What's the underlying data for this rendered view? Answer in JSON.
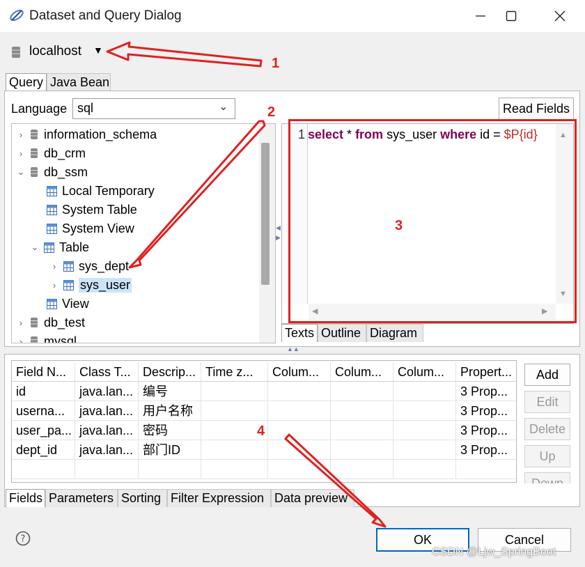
{
  "window": {
    "title": "Dataset and Query Dialog"
  },
  "datasource": {
    "label": "localhost"
  },
  "top_tabs": [
    {
      "label": "Query",
      "active": true
    },
    {
      "label": "Java Bean",
      "active": false
    }
  ],
  "language": {
    "label": "Language",
    "value": "sql"
  },
  "read_fields_label": "Read Fields",
  "tree": [
    {
      "label": "information_schema",
      "type": "db",
      "expand": "collapsed"
    },
    {
      "label": "db_crm",
      "type": "db",
      "expand": "collapsed"
    },
    {
      "label": "db_ssm",
      "type": "db",
      "expand": "expanded"
    },
    {
      "label": "Local Temporary",
      "type": "table-group",
      "expand": "none"
    },
    {
      "label": "System Table",
      "type": "table-group",
      "expand": "none"
    },
    {
      "label": "System View",
      "type": "table-group",
      "expand": "none"
    },
    {
      "label": "Table",
      "type": "table-group",
      "expand": "expanded"
    },
    {
      "label": "sys_dept",
      "type": "table",
      "expand": "collapsed"
    },
    {
      "label": "sys_user",
      "type": "table",
      "expand": "collapsed",
      "selected": true
    },
    {
      "label": "View",
      "type": "table-group",
      "expand": "none"
    },
    {
      "label": "db_test",
      "type": "db",
      "expand": "collapsed"
    },
    {
      "label": "mysql",
      "type": "db",
      "expand": "collapsed"
    }
  ],
  "editor": {
    "line_number": "1",
    "tokens": {
      "k1": "select",
      "t1": " * ",
      "k2": "from",
      "t2": " sys_user ",
      "k3": "where",
      "t3": " id = ",
      "p": "$P{id}"
    }
  },
  "editor_tabs": [
    {
      "label": "Texts",
      "active": true
    },
    {
      "label": "Outline",
      "active": false
    },
    {
      "label": "Diagram",
      "active": false
    }
  ],
  "fields_table": {
    "columns": [
      "Field N...",
      "Class T...",
      "Descrip...",
      "Time z...",
      "Colum...",
      "Colum...",
      "Colum...",
      "Propert..."
    ],
    "rows": [
      [
        "id",
        "java.lan...",
        "编号",
        "",
        "",
        "",
        "",
        "3 Prop..."
      ],
      [
        "userna...",
        "java.lan...",
        "用户名称",
        "",
        "",
        "",
        "",
        "3 Prop..."
      ],
      [
        "user_pa...",
        "java.lan...",
        "密码",
        "",
        "",
        "",
        "",
        "3 Prop..."
      ],
      [
        "dept_id",
        "java.lan...",
        "部门ID",
        "",
        "",
        "",
        "",
        "3 Prop..."
      ]
    ]
  },
  "side_buttons": [
    {
      "label": "Add",
      "enabled": true
    },
    {
      "label": "Edit",
      "enabled": false
    },
    {
      "label": "Delete",
      "enabled": false
    },
    {
      "label": "Up",
      "enabled": false
    },
    {
      "label": "Down",
      "enabled": false
    }
  ],
  "bottom_tabs": [
    {
      "label": "Fields",
      "active": true
    },
    {
      "label": "Parameters",
      "active": false
    },
    {
      "label": "Sorting",
      "active": false
    },
    {
      "label": "Filter Expression",
      "active": false
    },
    {
      "label": "Data preview",
      "active": false
    }
  ],
  "buttons": {
    "ok": "OK",
    "cancel": "Cancel"
  },
  "annotations": [
    "1",
    "2",
    "3",
    "4"
  ],
  "watermark": "CSDN @Ljw_SpringBoot",
  "colors": {
    "annotation": "#e02020",
    "keyword": "#7f0055",
    "param": "#c02a2a",
    "selection": "#cce4f7",
    "ok_border": "#0067c0"
  }
}
